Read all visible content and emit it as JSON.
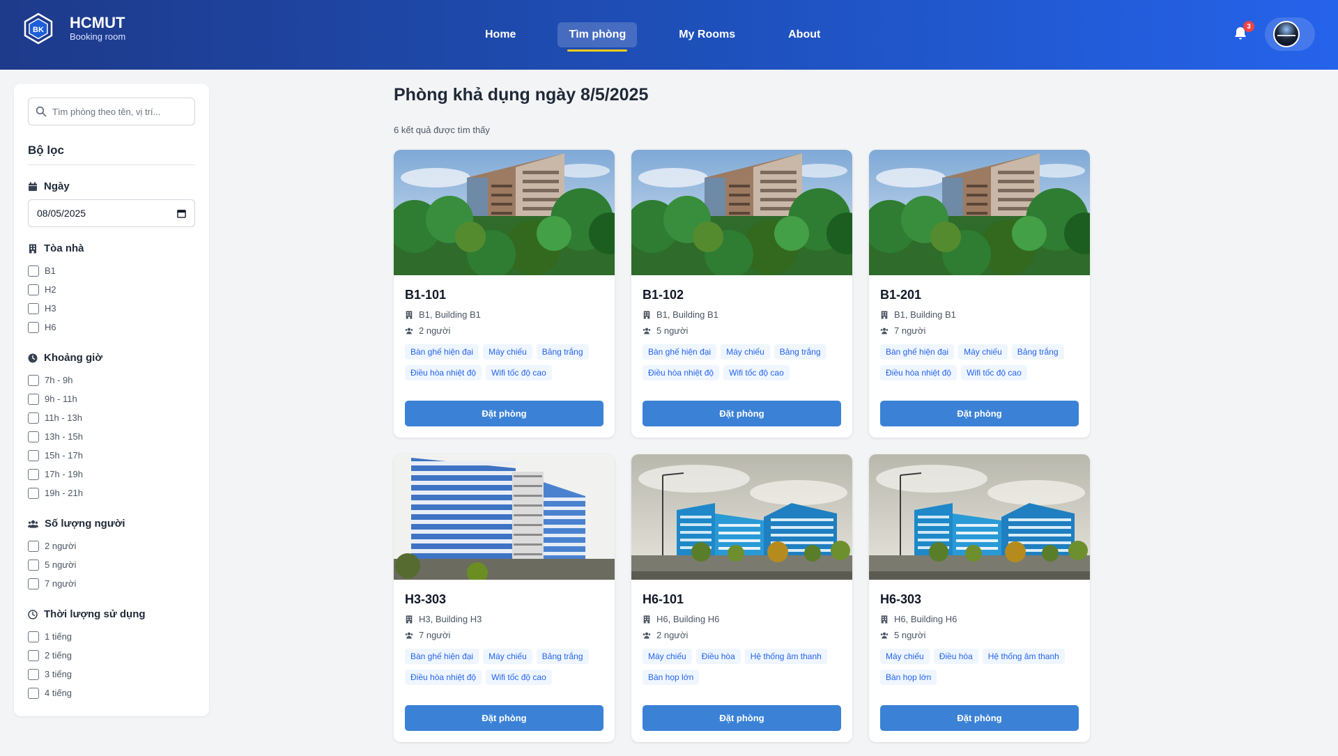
{
  "brand": {
    "title": "HCMUT",
    "subtitle": "Booking room",
    "logo_text": "BK"
  },
  "nav": [
    {
      "label": "Home",
      "active": false
    },
    {
      "label": "Tìm phòng",
      "active": true
    },
    {
      "label": "My Rooms",
      "active": false
    },
    {
      "label": "About",
      "active": false
    }
  ],
  "notifications": {
    "count": "3",
    "icon": "bell-icon"
  },
  "sidebar": {
    "search_placeholder": "Tìm phòng theo tên, vị trí...",
    "filter_title": "Bộ lọc",
    "date": {
      "label": "Ngày",
      "value": "08/05/2025"
    },
    "building": {
      "label": "Tòa nhà",
      "options": [
        "B1",
        "H2",
        "H3",
        "H6"
      ]
    },
    "time": {
      "label": "Khoảng giờ",
      "options": [
        "7h - 9h",
        "9h - 11h",
        "11h - 13h",
        "13h - 15h",
        "15h - 17h",
        "17h - 19h",
        "19h - 21h"
      ]
    },
    "people": {
      "label": "Số lượng người",
      "options": [
        "2 người",
        "5 người",
        "7 người"
      ]
    },
    "duration": {
      "label": "Thời lượng sử dụng",
      "options": [
        "1 tiếng",
        "2 tiếng",
        "3 tiếng",
        "4 tiếng"
      ]
    }
  },
  "main": {
    "title": "Phòng khả dụng ngày 8/5/2025",
    "result_count": "6 kết quả được tìm thấy",
    "book_label": "Đặt phòng",
    "rooms": [
      {
        "name": "B1-101",
        "location": "B1, Building B1",
        "capacity": "2 người",
        "image": "b1",
        "tags": [
          "Bàn ghế hiện đại",
          "Máy chiếu",
          "Bảng trắng",
          "Điều hòa nhiệt độ",
          "Wifi tốc độ cao"
        ]
      },
      {
        "name": "B1-102",
        "location": "B1, Building B1",
        "capacity": "5 người",
        "image": "b1",
        "tags": [
          "Bàn ghế hiện đại",
          "Máy chiếu",
          "Bảng trắng",
          "Điều hòa nhiệt độ",
          "Wifi tốc độ cao"
        ]
      },
      {
        "name": "B1-201",
        "location": "B1, Building B1",
        "capacity": "7 người",
        "image": "b1",
        "tags": [
          "Bàn ghế hiện đại",
          "Máy chiếu",
          "Bảng trắng",
          "Điều hòa nhiệt độ",
          "Wifi tốc độ cao"
        ]
      },
      {
        "name": "H3-303",
        "location": "H3, Building H3",
        "capacity": "7 người",
        "image": "h3",
        "tags": [
          "Bàn ghế hiện đại",
          "Máy chiếu",
          "Bảng trắng",
          "Điều hòa nhiệt độ",
          "Wifi tốc độ cao"
        ]
      },
      {
        "name": "H6-101",
        "location": "H6, Building H6",
        "capacity": "2 người",
        "image": "h6",
        "tags": [
          "Máy chiếu",
          "Điều hòa",
          "Hệ thống âm thanh",
          "Bàn họp lớn"
        ]
      },
      {
        "name": "H6-303",
        "location": "H6, Building H6",
        "capacity": "5 người",
        "image": "h6",
        "tags": [
          "Máy chiếu",
          "Điều hòa",
          "Hệ thống âm thanh",
          "Bàn họp lớn"
        ]
      }
    ]
  },
  "colors": {
    "header_start": "#1e3a8a",
    "header_end": "#2563eb",
    "button": "#3b82d6",
    "tag_text": "#2563eb",
    "active_underline": "#facc15",
    "badge": "#ef4444"
  }
}
